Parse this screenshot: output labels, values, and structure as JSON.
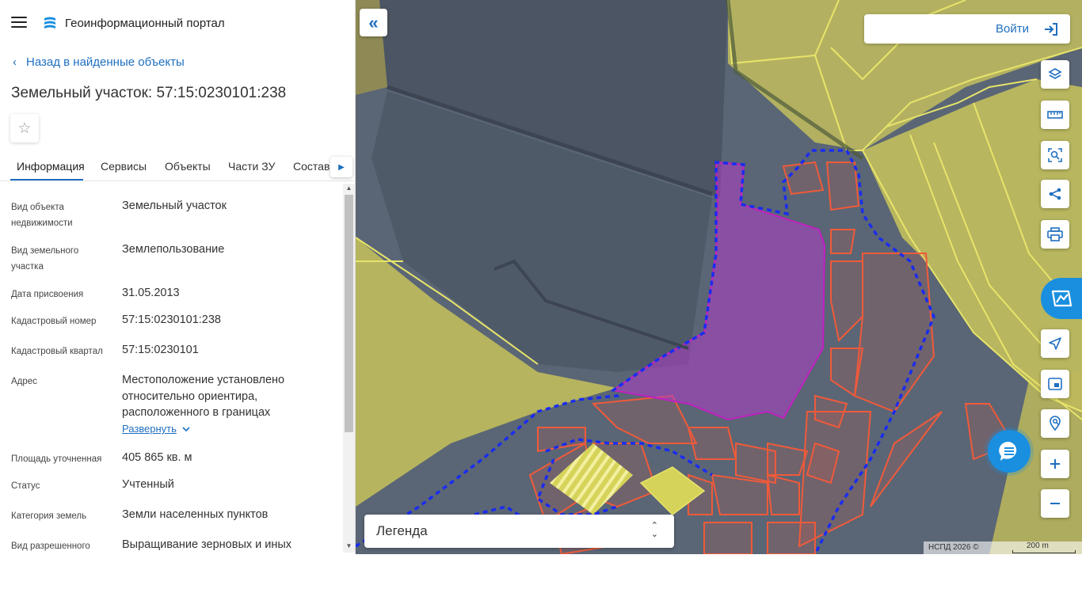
{
  "header": {
    "portal_title": "Геоинформационный портал"
  },
  "nav": {
    "back_label": "Назад в найденные объекты"
  },
  "object": {
    "title": "Земельный участок: 57:15:0230101:238"
  },
  "tabs": [
    {
      "label": "Информация",
      "active": true
    },
    {
      "label": "Сервисы",
      "active": false
    },
    {
      "label": "Объекты",
      "active": false
    },
    {
      "label": "Части ЗУ",
      "active": false
    },
    {
      "label": "Состав",
      "active": false
    }
  ],
  "properties": [
    {
      "label": "Вид объекта недвижимости",
      "value": "Земельный участок"
    },
    {
      "label": "Вид земельного участка",
      "value": "Землепользование"
    },
    {
      "label": "Дата присвоения",
      "value": "31.05.2013"
    },
    {
      "label": "Кадастровый номер",
      "value": "57:15:0230101:238"
    },
    {
      "label": "Кадастровый квартал",
      "value": "57:15:0230101"
    },
    {
      "label": "Адрес",
      "value": "Местоположение установлено относительно ориентира, расположенного в границах"
    },
    {
      "label": "Площадь уточненная",
      "value": "405 865 кв. м"
    },
    {
      "label": "Статус",
      "value": "Учтенный"
    },
    {
      "label": "Категория земель",
      "value": "Земли населенных пунктов"
    },
    {
      "label": "Вид разрешенного",
      "value": "Выращивание зерновых и иных"
    }
  ],
  "expand_label": "Развернуть",
  "map": {
    "login_label": "Войти",
    "legend_label": "Легенда",
    "attribution": "НСПД 2026 ©",
    "scale_label": "200 m",
    "tools": [
      "layers-icon",
      "ruler-icon",
      "area-select-icon",
      "share-icon",
      "print-icon",
      "location-arrow-icon",
      "minimap-icon",
      "pin-search-icon",
      "zoom-in-icon",
      "zoom-out-icon"
    ]
  },
  "colors": {
    "accent": "#1f6fc0",
    "nspd_blue": "#1a8fe0",
    "parcel_yellow": "#e8e46a",
    "selected_magenta": "#b03cc8",
    "boundary_blue": "#1a2cf0",
    "parcel_red": "#f05a3a"
  }
}
